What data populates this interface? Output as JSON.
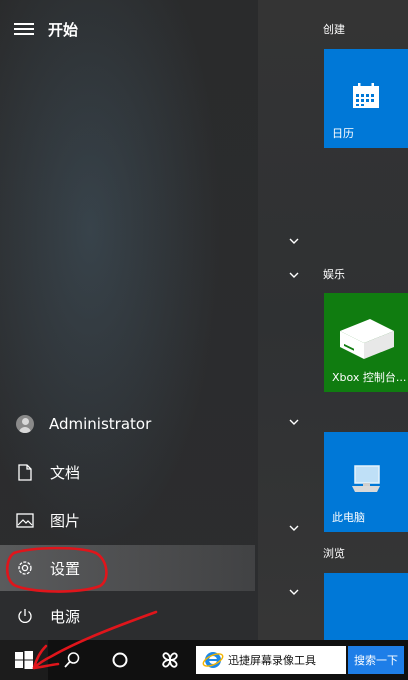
{
  "start_menu": {
    "title": "开始",
    "user": {
      "name": "Administrator"
    },
    "nav": {
      "documents": "文档",
      "pictures": "图片",
      "settings": "设置",
      "power": "电源"
    }
  },
  "tiles": {
    "section_create": "创建",
    "section_entertainment": "娱乐",
    "section_browse": "浏览",
    "calendar_label": "日历",
    "xbox_label": "Xbox 控制台...",
    "this_pc_label": "此电脑"
  },
  "taskbar": {
    "search_value": "迅捷屏幕录像工具",
    "search_button": "搜索一下"
  },
  "colors": {
    "tile_blue": "#0078d7",
    "tile_green": "#107c10",
    "annotation_red": "#e0151b",
    "search_button_blue": "#1e7ee8"
  },
  "icons": {
    "menu": "hamburger-icon",
    "user": "user-avatar-icon",
    "documents": "document-icon",
    "pictures": "picture-icon",
    "settings": "gear-icon",
    "power": "power-icon",
    "calendar": "calendar-icon",
    "xbox": "xbox-console-icon",
    "this_pc": "computer-icon",
    "start": "windows-logo-icon",
    "search": "search-icon",
    "cortana": "cortana-circle-icon",
    "taskbar_app": "pinwheel-app-icon",
    "browser": "ie-browser-icon"
  }
}
